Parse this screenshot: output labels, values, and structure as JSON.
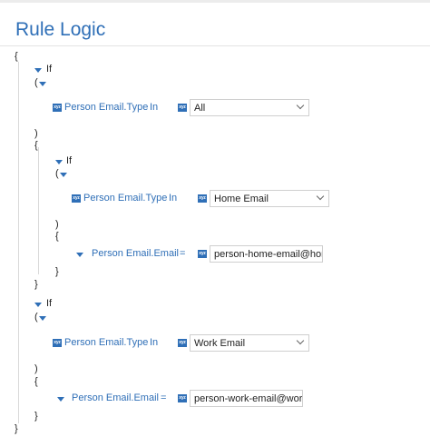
{
  "header": {
    "title": "Rule Logic"
  },
  "icons": {
    "field_type": "xyz",
    "field_type_icon": "xyz-field-type-icon",
    "collapse_icon": "triangle-down-icon",
    "dropdown_icon": "chevron-down-icon"
  },
  "colors": {
    "accent": "#2f6fb7"
  },
  "syntax": {
    "open_brace": "{",
    "close_brace": "}",
    "open_paren": "(",
    "close_paren": ")",
    "if_label": "If",
    "in_op": "In",
    "eq_op": "="
  },
  "rule1": {
    "field": "Person Email.Type",
    "operator": "In",
    "value": "All"
  },
  "rule2": {
    "field": "Person Email.Type",
    "operator": "In",
    "value": "Home Email",
    "action_field": "Person Email.Email",
    "action_op": "=",
    "action_value": "person-home-email@hon"
  },
  "rule3": {
    "field": "Person Email.Type",
    "operator": "In",
    "value": "Work Email",
    "action_field": "Person Email.Email",
    "action_op": "=",
    "action_value": "person-work-email@work"
  }
}
